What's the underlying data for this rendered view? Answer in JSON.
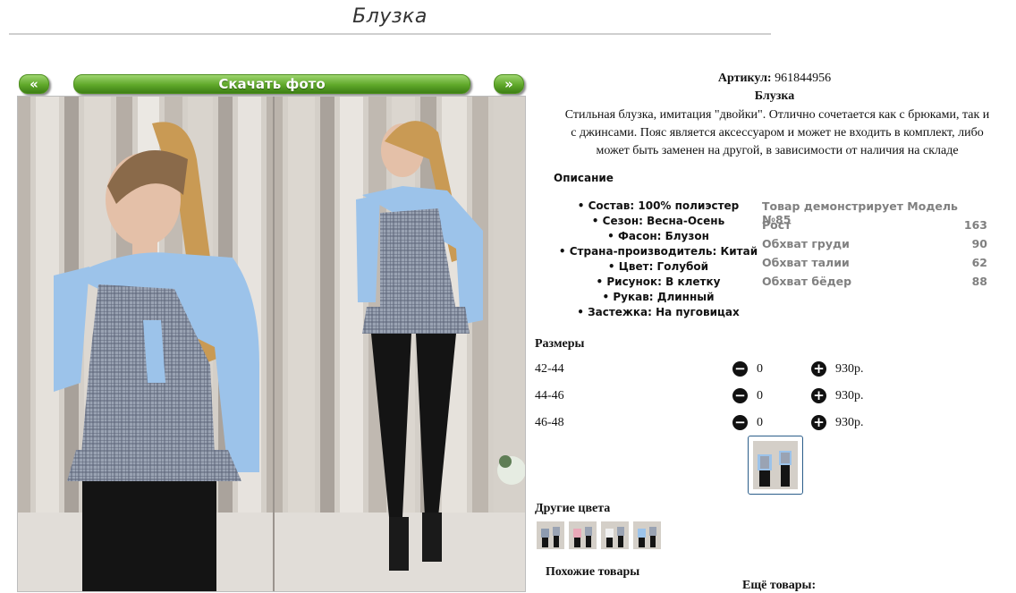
{
  "page": {
    "title": "Блузка"
  },
  "gallery": {
    "prev_label": "«",
    "download_label": "Скачать фото",
    "next_label": "»"
  },
  "product": {
    "sku_label": "Артикул:",
    "sku_value": "961844956",
    "name": "Блузка",
    "description_lines": [
      "Стильная блузка, имитация \"двойки\". Отлично сочетается как с брюками, так и",
      "с джинсами. Пояс является аксессуаром и может не входить в комплект, либо",
      "может быть заменен на другой, в зависимости от наличия на складе"
    ],
    "description_heading": "Описание",
    "attributes": [
      "Состав: 100% полиэстер",
      "Сезон: Весна-Осень",
      "Фасон: Блузон",
      "Страна-производитель: Китай",
      "Цвет: Голубой",
      "Рисунок: В клетку",
      "Рукав: Длинный",
      "Застежка: На пуговицах"
    ]
  },
  "model": {
    "title": "Товар демонстрирует Модель №85",
    "rows": [
      {
        "label": "Рост",
        "value": "163"
      },
      {
        "label": "Обхват груди",
        "value": "90"
      },
      {
        "label": "Обхват талии",
        "value": "62"
      },
      {
        "label": "Обхват бёдер",
        "value": "88"
      }
    ]
  },
  "sizes": {
    "heading": "Размеры",
    "rows": [
      {
        "name": "42-44",
        "qty": "0",
        "price": "930р."
      },
      {
        "name": "44-46",
        "qty": "0",
        "price": "930р."
      },
      {
        "name": "46-48",
        "qty": "0",
        "price": "930р."
      }
    ]
  },
  "other_colors": {
    "heading": "Другие цвета"
  },
  "footer": {
    "similar_label": "Похожие товары",
    "more_label": "Ещё товары:"
  },
  "icons": {
    "minus": "minus-circle-icon",
    "plus": "plus-circle-icon"
  },
  "colors": {
    "button_green": "#5fa829",
    "blouse_blue": "#9cc3ea",
    "thumb_border": "#2b5d8a",
    "model_text": "#808080"
  }
}
